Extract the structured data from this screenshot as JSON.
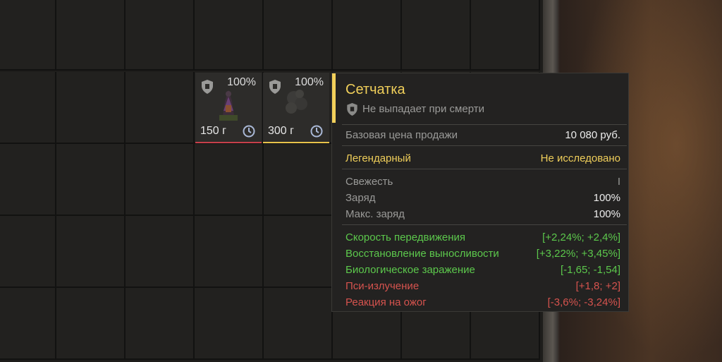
{
  "inventory": {
    "items": [
      {
        "durability": "100%",
        "weight": "150 г",
        "bar_color": "#c7404a"
      },
      {
        "durability": "100%",
        "weight": "300 г",
        "bar_color": "#e8c24a"
      }
    ]
  },
  "tooltip": {
    "title": "Сетчатка",
    "subtitle": "Не выпадает при смерти",
    "price_label": "Базовая цена продажи",
    "price_value": "10 080 руб.",
    "rarity": "Легендарный",
    "research_status": "Не исследовано",
    "stats": [
      {
        "label": "Свежесть",
        "value": "I"
      },
      {
        "label": "Заряд",
        "value": "100%"
      },
      {
        "label": "Макс. заряд",
        "value": "100%"
      }
    ],
    "effects": [
      {
        "label": "Скорость передвижения",
        "value": "[+2,24%; +2,4%]",
        "tone": "positive"
      },
      {
        "label": "Восстановление выносливости",
        "value": "[+3,22%; +3,45%]",
        "tone": "positive"
      },
      {
        "label": "Биологическое заражение",
        "value": "[-1,65; -1,54]",
        "tone": "positive"
      },
      {
        "label": "Пси-излучение",
        "value": "[+1,8; +2]",
        "tone": "negative"
      },
      {
        "label": "Реакция на ожог",
        "value": "[-3,6%; -3,24%]",
        "tone": "negative"
      }
    ]
  },
  "colors": {
    "legendary": "#efce5a",
    "positive": "#5cc84c",
    "negative": "#d6534e"
  },
  "icons": [
    "shield-icon",
    "clock-icon"
  ]
}
